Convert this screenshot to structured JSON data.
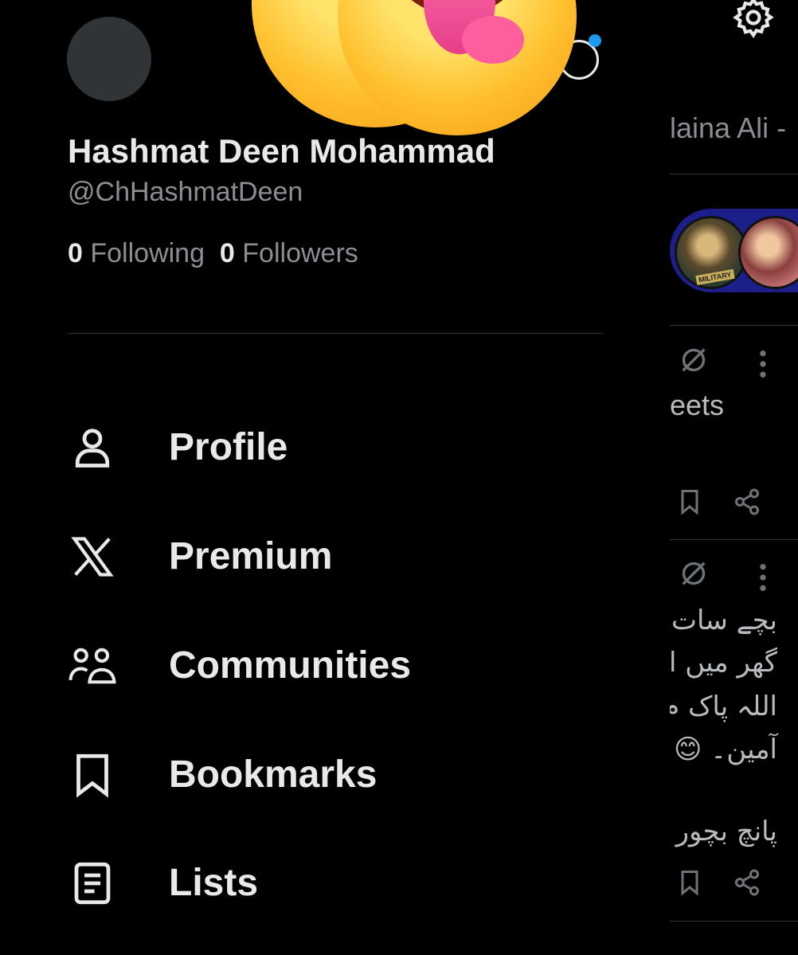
{
  "profile": {
    "display_name": "Hashmat Deen Mohammad",
    "handle": "@ChHashmatDeen",
    "following_count": "0",
    "following_label": "Following",
    "followers_count": "0",
    "followers_label": "Followers"
  },
  "nav": {
    "items": [
      {
        "label": "Profile",
        "icon": "person-icon"
      },
      {
        "label": "Premium",
        "icon": "x-logo-icon"
      },
      {
        "label": "Communities",
        "icon": "people-icon"
      },
      {
        "label": "Bookmarks",
        "icon": "bookmark-icon"
      },
      {
        "label": "Lists",
        "icon": "list-icon"
      }
    ]
  },
  "feed": {
    "account_name_partial": "laina Ali -",
    "post_1_text_partial": "eets",
    "post_2_urdu_lines": [
      "بچے سات",
      "گھر میں ا",
      "اللہ پاک م",
      "آمین۔ 😊"
    ],
    "post_2_urdu_extra": "پانچ بچور"
  },
  "colors": {
    "background": "#000000",
    "primary_text": "#e7e9ea",
    "secondary_text": "#8b8f93",
    "accent": "#1d9bf0",
    "divider": "#2f3336"
  }
}
